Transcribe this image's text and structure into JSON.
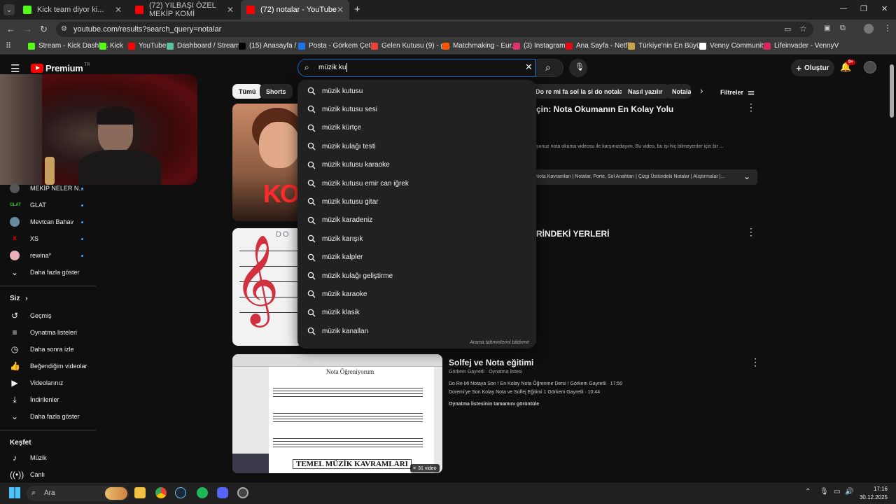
{
  "browser": {
    "tabs": [
      {
        "label": "Kick team diyor ki...",
        "fav_color": "#53fc18"
      },
      {
        "label": "(72) YILBAŞI ÖZEL MEKİP KOMİ",
        "fav_color": "#ff0000"
      },
      {
        "label": "(72) notalar - YouTube",
        "fav_color": "#ff0000"
      }
    ],
    "new_tab": "+",
    "url": "youtube.com/results?search_query=notalar",
    "bookmarks": [
      {
        "label": "Stream - Kick Dashb...",
        "color": "#53fc18"
      },
      {
        "label": "Kick",
        "color": "#53fc18"
      },
      {
        "label": "YouTube",
        "color": "#ff0000"
      },
      {
        "label": "Dashboard / Stream...",
        "color": "#5cc3a0"
      },
      {
        "label": "(15) Anasayfa / X",
        "color": "#000000"
      },
      {
        "label": "Posta - Görkem Çeti...",
        "color": "#1a73e8"
      },
      {
        "label": "Gelen Kutusu (9) - g...",
        "color": "#ea4335"
      },
      {
        "label": "Matchmaking - Eur...",
        "color": "#ff5500"
      },
      {
        "label": "(3) Instagram",
        "color": "#e1306c"
      },
      {
        "label": "Ana Sayfa - Netflix",
        "color": "#e50914"
      },
      {
        "label": "Türkiye'nin En Büyü...",
        "color": "#c7a34a"
      },
      {
        "label": "Venny Community",
        "color": "#ffffff"
      },
      {
        "label": "Lifeinvader - VennyV",
        "color": "#e0245e"
      }
    ]
  },
  "header": {
    "logo": "Premium",
    "logo_sup": "TR",
    "search_value": "müzik ku",
    "create": "Oluştur",
    "notif_badge": "9+"
  },
  "chips": [
    {
      "label": "Tümü",
      "selected": true
    },
    {
      "label": "Shorts"
    },
    {
      "label": "Do re mi fa sol la si do notaları"
    },
    {
      "label": "Nasıl yazılır"
    },
    {
      "label": "Notala"
    }
  ],
  "filters": "Filtreler",
  "sidebar": {
    "subs": [
      {
        "label": "MEKİP NELER N...",
        "color": "#555"
      },
      {
        "label": "GLAT",
        "color": "#1a6b2a"
      },
      {
        "label": "Mevtcan Bahav",
        "color": "#6a8aa0"
      },
      {
        "label": "XS",
        "color": "#000"
      },
      {
        "label": "rewina*",
        "color": "#e8b0b8"
      }
    ],
    "show_more": "Daha fazla göster",
    "you_title": "Siz",
    "you_items": [
      "Geçmiş",
      "Oynatma listeleri",
      "Daha sonra izle",
      "Beğendiğim videolar",
      "Videolarınız",
      "İndirilenler"
    ],
    "show_more2": "Daha fazla göster",
    "explore_title": "Keşfet",
    "explore_items": [
      "Müzik",
      "Canlı"
    ]
  },
  "results": [
    {
      "title": "çin: Nota Okumanın En Kolay Yolu",
      "desc": "şunuz nota okuma videosu ile karşınızdayım. Bu video, bu işi hiç bilmeyenler için bir ...",
      "chapters": "Nota Kavramları | Notalar, Porte, Sol Anahtarı | Çizgi Üstündeki Notalar | Alıştırmalar |...",
      "thumb_text": "KO"
    },
    {
      "title": "RİNDEKİ YERLERİ",
      "thumb_text": "DO"
    },
    {
      "title": "Solfej ve Nota eğitimi",
      "channel": "Görkem Gayretli",
      "kind": "Oynatma listesi",
      "line1": "Do Re Mi Notaya Son ! En Kolay Nota Öğrenme Dersi ! Görkem Gayretli · 17:50",
      "line2": "Doremi'ye Son Kolay Nota ve Solfej Eğitimi 1 Görkem Gayretli · 10:44",
      "view_all": "Oynatma listesinin tamamını görüntüle",
      "thumb_title": "Nota Öğreniyorum",
      "thumb_footer": "TEMEL MÜZİK KAVRAMLARI",
      "badge": "31 video"
    }
  ],
  "suggestions": [
    "müzik kutusu",
    "müzik kutusu sesi",
    "müzik kürtçe",
    "müzik kulağı testi",
    "müzik kutusu karaoke",
    "müzik kutusu emir can iğrek",
    "müzik kutusu gitar",
    "müzik karadeniz",
    "müzik karışık",
    "müzik kalpler",
    "müzik kulağı geliştirme",
    "müzik karaoke",
    "müzik klasik",
    "müzik kanalları"
  ],
  "suggest_footer": "Arama tahminlerini bildirme",
  "taskbar": {
    "search": "Ara",
    "time": "17:16",
    "date": "30.12.2025"
  }
}
